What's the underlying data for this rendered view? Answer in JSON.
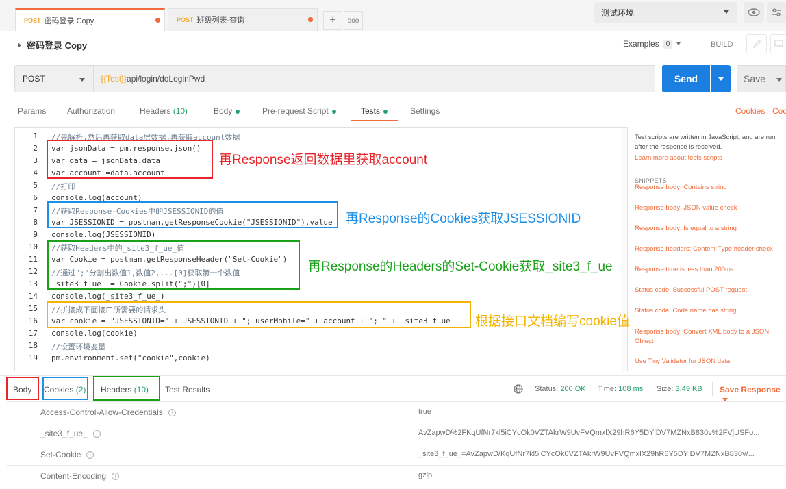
{
  "tabs": [
    {
      "method": "POST",
      "label": "密码登录 Copy"
    },
    {
      "method": "POST",
      "label": "班级列表-查询"
    }
  ],
  "tab_more": "ooo",
  "environment": {
    "selected": "测试环境"
  },
  "request": {
    "name": "密码登录 Copy",
    "examples_label": "Examples",
    "examples_count": "0",
    "build_label": "BUILD",
    "method": "POST",
    "url_var": "{{Test}}",
    "url_path": "api/login/doLoginPwd",
    "send_label": "Send",
    "save_label": "Save"
  },
  "request_tabs": {
    "params": "Params",
    "authorization": "Authorization",
    "headers": "Headers",
    "headers_count": "(10)",
    "body": "Body",
    "prerequest": "Pre-request Script",
    "tests": "Tests",
    "settings": "Settings",
    "cookies": "Cookies",
    "code": "Coc"
  },
  "editor": {
    "lines": [
      {
        "n": "1",
        "text": "//先解析,然后再获取data层数据,再获取account数据"
      },
      {
        "n": "2",
        "text": "var jsonData = pm.response.json()"
      },
      {
        "n": "3",
        "text": "var data = jsonData.data"
      },
      {
        "n": "4",
        "text": "var account =data.account"
      },
      {
        "n": "5",
        "text": "//打印"
      },
      {
        "n": "6",
        "text": "console.log(account)"
      },
      {
        "n": "7",
        "text": "//获取Response-Cookies中的JSESSIONID的值"
      },
      {
        "n": "8",
        "text": "var JSESSIONID = postman.getResponseCookie(\"JSESSIONID\").value"
      },
      {
        "n": "9",
        "text": "console.log(JSESSIONID)"
      },
      {
        "n": "10",
        "text": "//获取Headers中的_site3_f_ue_值"
      },
      {
        "n": "11",
        "text": "var Cookie = postman.getResponseHeader(\"Set-Cookie\")"
      },
      {
        "n": "12",
        "text": "//通过\";\"分割出数值1,数值2,...[0]获取第一个数值"
      },
      {
        "n": "13",
        "text": "_site3_f_ue_ = Cookie.split(\";\")[0]"
      },
      {
        "n": "14",
        "text": "console.log(_site3_f_ue_)"
      },
      {
        "n": "15",
        "text": "//拼接成下面接口所需要的请求头"
      },
      {
        "n": "16",
        "text": "var cookie = \"JSESSIONID=\" + JSESSIONID + \"; userMobile=\" + account + \"; \" + _site3_f_ue_"
      },
      {
        "n": "17",
        "text": "console.log(cookie)"
      },
      {
        "n": "18",
        "text": "//设置环境变量"
      },
      {
        "n": "19",
        "text": "pm.environment.set(\"cookie\",cookie)"
      }
    ]
  },
  "annotations": {
    "a1": "再Response返回数据里获取account",
    "a2": "再Response的Cookies获取JSESSIONID",
    "a3": "再Response的Headers的Set-Cookie获取_site3_f_ue",
    "a4": "根据接口文档编写cookie值",
    "colors": {
      "red": "#e8252a",
      "blue": "#1e8fe6",
      "green": "#1aa11a",
      "orange": "#f2b400"
    }
  },
  "side_panel": {
    "intro": "Test scripts are written in JavaScript, and are run after the response is received.",
    "learn_link": "Learn more about tests scripts",
    "snippets_heading": "SNIPPETS",
    "snippets": [
      "Response body: Contains string",
      "Response body: JSON value check",
      "Response body: Is equal to a string",
      "Response headers: Content-Type header check",
      "Response time is less than 200ms",
      "Status code: Successful POST request",
      "Status code: Code name has string",
      "Response body: Convert XML body to a JSON Object",
      "Use Tiny Validator for JSON data"
    ]
  },
  "response": {
    "tabs": {
      "body": "Body",
      "cookies": "Cookies",
      "cookies_count": "(2)",
      "headers": "Headers",
      "headers_count": "(10)",
      "test_results": "Test Results"
    },
    "status_label": "Status:",
    "status_value": "200 OK",
    "time_label": "Time:",
    "time_value": "108 ms",
    "size_label": "Size:",
    "size_value": "3.49 KB",
    "save_response": "Save Response",
    "headers": [
      {
        "key": "Access-Control-Allow-Credentials",
        "value": "true"
      },
      {
        "key": "_site3_f_ue_",
        "value": "AvZapwD%2FKqUfNr7kl5iCYcOk0VZTAkrW9UvFVQmxlX29hR6Y5DYlDV7MZNxB830v%2FVjUSFo..."
      },
      {
        "key": "Set-Cookie",
        "value": "_site3_f_ue_=AvZapwD/KqUfNr7kl5iCYcOk0VZTAkrW9UvFVQmxlX29hR6Y5DYlDV7MZNxB830v/..."
      },
      {
        "key": "Content-Encoding",
        "value": "gzip"
      }
    ]
  }
}
